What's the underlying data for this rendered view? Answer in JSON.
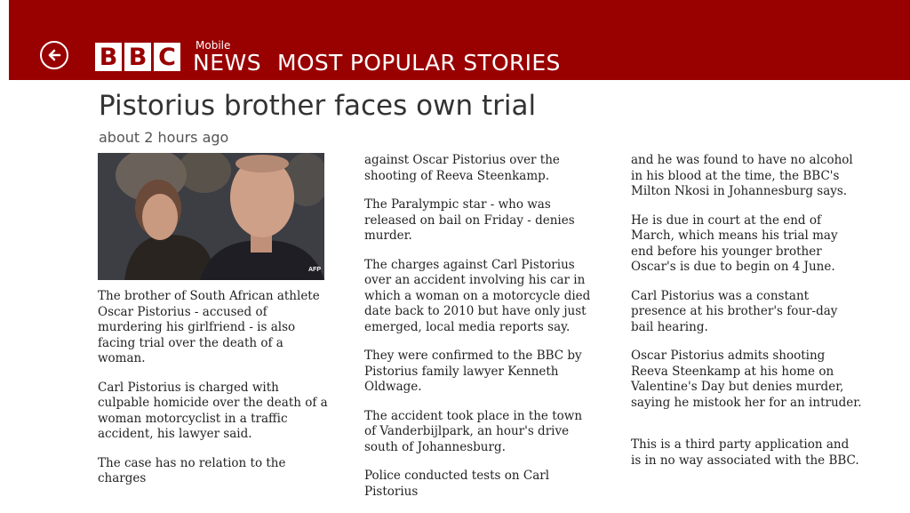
{
  "header": {
    "brand_letters": [
      "B",
      "B",
      "C"
    ],
    "brand_mobile": "Mobile",
    "brand_news": "NEWS",
    "section_title": "MOST POPULAR STORIES",
    "back_icon": "back-arrow-circle-icon",
    "background_color": "#990000"
  },
  "article": {
    "headline": "Pistorius brother faces own trial",
    "timestamp": "about 2 hours ago",
    "image": {
      "agency": "AFP"
    },
    "columns": [
      [
        "The brother of South African athlete Oscar Pistorius - accused of murdering his girlfriend - is also facing trial over the death of a woman.",
        "Carl Pistorius is charged with culpable homicide over the death of a woman motorcyclist in a traffic accident, his lawyer said.",
        "The case has no relation to the charges"
      ],
      [
        "against Oscar Pistorius over the shooting of Reeva Steenkamp.",
        "The Paralympic star - who was released on bail on Friday - denies murder.",
        "The charges against Carl Pistorius over an accident involving his car in which a woman on a motorcycle died date back to 2010 but have only just emerged, local media reports say.",
        "They were confirmed to the BBC by Pistorius family lawyer Kenneth Oldwage.",
        "The accident took place in the town of Vanderbijlpark, an hour's drive south of Johannesburg.",
        "Police conducted tests on Carl Pistorius"
      ],
      [
        "and he was found to have no alcohol in his blood at the time, the BBC's Milton Nkosi in Johannesburg says.",
        "He is due in court at the end of March, which means his trial may end before his younger brother Oscar's is due to begin on 4 June.",
        "Carl Pistorius was a constant presence at his brother's four-day bail hearing.",
        "Oscar Pistorius admits shooting Reeva Steenkamp at his home on Valentine's Day but denies murder, saying he mistook her for an intruder."
      ]
    ],
    "disclaimer": "This is a third party application and is in no way associated with the BBC."
  }
}
